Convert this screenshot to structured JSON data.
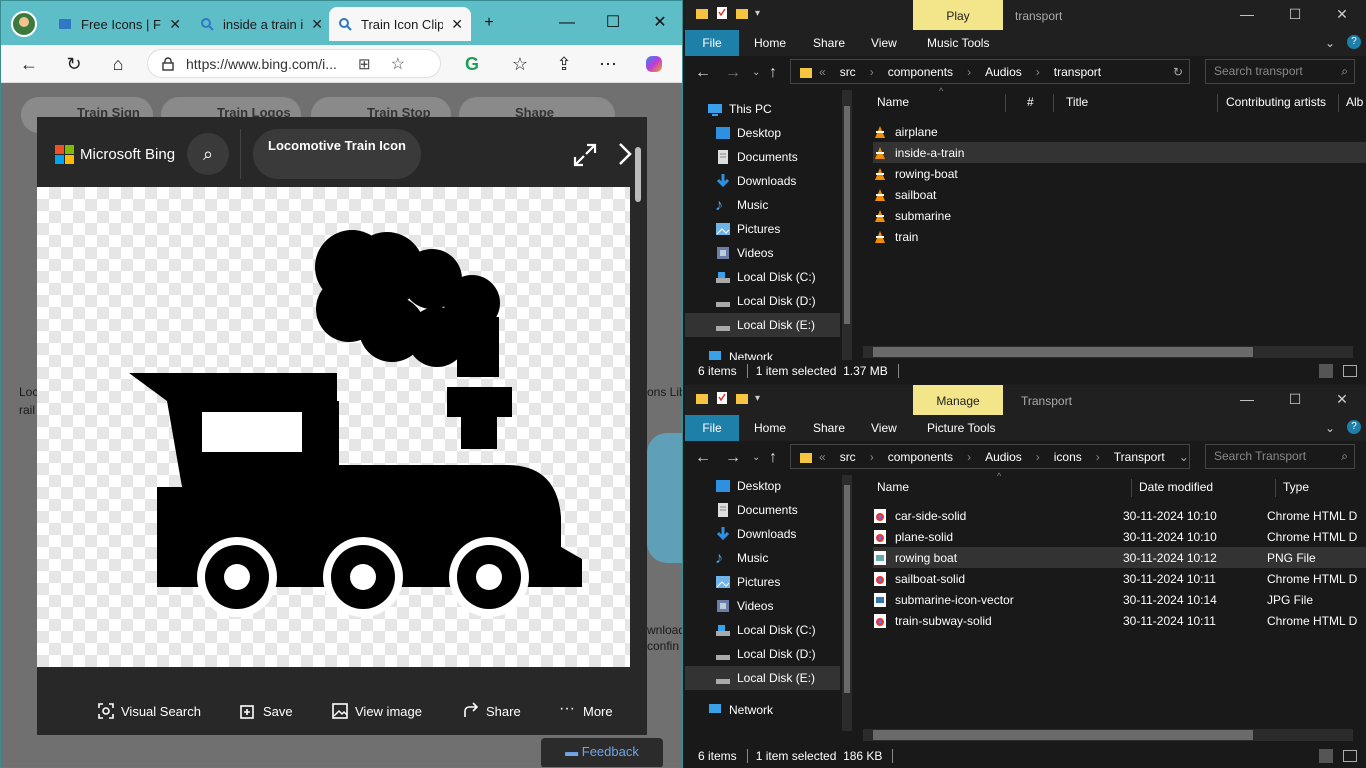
{
  "browser": {
    "tabs": [
      {
        "title": "Free Icons | For",
        "active": false
      },
      {
        "title": "inside a train ic",
        "active": false
      },
      {
        "title": "Train Icon Clip",
        "active": true
      }
    ],
    "url": "https://www.bing.com/i...",
    "chips": [
      "Train Sign",
      "Train Logos",
      "Train Stop",
      "Shape"
    ],
    "bg_text": {
      "loc": "Loc",
      "rail": "rail",
      "ons_lib": "ons Lib",
      "ownload": "wnload",
      "confin": "confin"
    }
  },
  "viewer": {
    "brand": "Microsoft Bing",
    "title": "Locomotive Train Icon",
    "actions": [
      "Visual Search",
      "Save",
      "View image",
      "Share",
      "More"
    ],
    "feedback": "Feedback"
  },
  "explorer_top": {
    "context_tab": "Play",
    "window_title": "transport",
    "ribbon": [
      "File",
      "Home",
      "Share",
      "View",
      "Music Tools"
    ],
    "path": [
      "src",
      "components",
      "Audios",
      "transport"
    ],
    "search_placeholder": "Search transport",
    "nav_items": [
      "This PC",
      "Desktop",
      "Documents",
      "Downloads",
      "Music",
      "Pictures",
      "Videos",
      "Local Disk (C:)",
      "Local Disk (D:)",
      "Local Disk (E:)",
      "Network"
    ],
    "selected_nav": "Local Disk (E:)",
    "columns": [
      "Name",
      "#",
      "Title",
      "Contributing artists",
      "Alb"
    ],
    "files": [
      {
        "name": "airplane",
        "selected": false
      },
      {
        "name": "inside-a-train",
        "selected": true
      },
      {
        "name": "rowing-boat",
        "selected": false
      },
      {
        "name": "sailboat",
        "selected": false
      },
      {
        "name": "submarine",
        "selected": false
      },
      {
        "name": "train",
        "selected": false
      }
    ],
    "status": {
      "count": "6 items",
      "selection": "1 item selected  1.37 MB"
    }
  },
  "explorer_bottom": {
    "context_tab": "Manage",
    "window_title": "Transport",
    "ribbon": [
      "File",
      "Home",
      "Share",
      "View",
      "Picture Tools"
    ],
    "path": [
      "src",
      "components",
      "Audios",
      "icons",
      "Transport"
    ],
    "search_placeholder": "Search Transport",
    "nav_items": [
      "Desktop",
      "Documents",
      "Downloads",
      "Music",
      "Pictures",
      "Videos",
      "Local Disk (C:)",
      "Local Disk (D:)",
      "Local Disk (E:)",
      "Network"
    ],
    "selected_nav": "Local Disk (E:)",
    "columns": [
      "Name",
      "Date modified",
      "Type"
    ],
    "files": [
      {
        "name": "car-side-solid",
        "date": "30-11-2024 10:10",
        "type": "Chrome HTML D",
        "icon": "chrome-html-icon",
        "selected": false
      },
      {
        "name": "plane-solid",
        "date": "30-11-2024 10:10",
        "type": "Chrome HTML D",
        "icon": "chrome-html-icon",
        "selected": false
      },
      {
        "name": "rowing boat",
        "date": "30-11-2024 10:12",
        "type": "PNG File",
        "icon": "png-file-icon",
        "selected": true
      },
      {
        "name": "sailboat-solid",
        "date": "30-11-2024 10:11",
        "type": "Chrome HTML D",
        "icon": "chrome-html-icon",
        "selected": false
      },
      {
        "name": "submarine-icon-vector",
        "date": "30-11-2024 10:14",
        "type": "JPG File",
        "icon": "jpg-file-icon",
        "selected": false
      },
      {
        "name": "train-subway-solid",
        "date": "30-11-2024 10:11",
        "type": "Chrome HTML D",
        "icon": "chrome-html-icon",
        "selected": false
      }
    ],
    "status": {
      "count": "6 items",
      "selection": "1 item selected  186 KB"
    }
  },
  "colors": {
    "accent_tab": "#5dbec7",
    "ribbon_file": "#1e7fa8",
    "context_tab": "#f2e58a",
    "vlc_orange": "#f28c00"
  }
}
